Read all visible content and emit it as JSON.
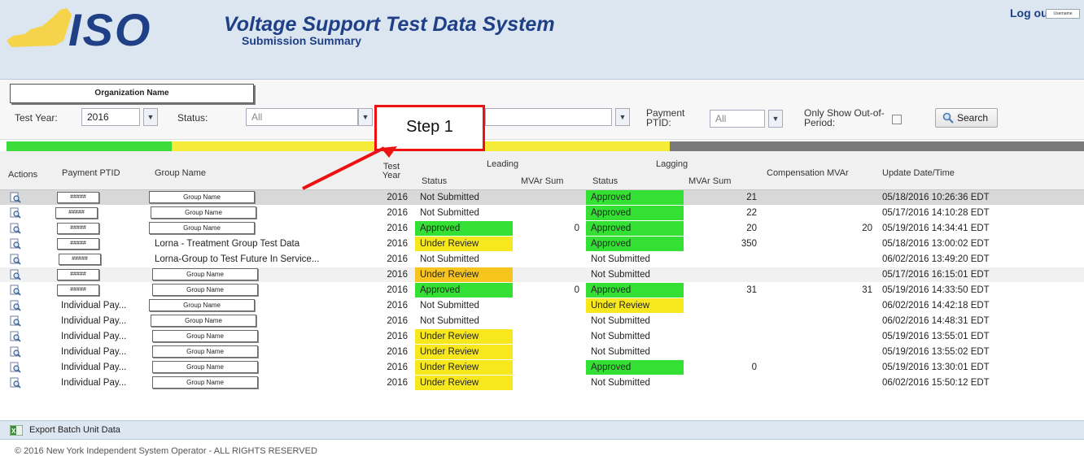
{
  "header": {
    "logo_text": "ISO",
    "title": "Voltage Support Test Data System",
    "subtitle": "Submission Summary",
    "logout_label": "Log out",
    "username": "Username"
  },
  "filters": {
    "organization": "Organization Name",
    "test_year_label": "Test Year:",
    "test_year_value": "2016",
    "status_label": "Status:",
    "status_value": "All",
    "payment_ptid_label": "Payment PTID:",
    "payment_ptid_value": "All",
    "out_of_period_label": "Only Show Out-of-Period:",
    "search_label": "Search"
  },
  "annotation": {
    "step_label": "Step 1",
    "color": "#e11111"
  },
  "colors": {
    "approved": "#34e034",
    "under_review": "#f7e81e",
    "under_review_orange": "#f7c51e",
    "bar_green": "#3ddc3d",
    "bar_yellow": "#f5ec3a",
    "bar_gray": "#7a7a7a"
  },
  "table": {
    "headers": {
      "actions": "Actions",
      "payment_ptid": "Payment PTID",
      "group_name": "Group Name",
      "test_year": "Test Year",
      "leading": "Leading",
      "lagging": "Lagging",
      "status": "Status",
      "mvar_sum": "MVAr Sum",
      "compensation": "Compensation MVAr",
      "update": "Update Date/Time"
    },
    "rows": [
      {
        "ptid": "#####",
        "ptid_boxed": true,
        "group": "Group Name",
        "group_boxed": true,
        "year": "2016",
        "lead_status": "Not Submitted",
        "lead_style": "none",
        "lead_mvar": "",
        "lag_status": "Approved",
        "lag_style": "approved",
        "lag_mvar": "21",
        "comp": "",
        "updated": "05/18/2016 10:26:36 EDT"
      },
      {
        "ptid": "#####",
        "ptid_boxed": true,
        "group": "Group Name",
        "group_boxed": true,
        "year": "2016",
        "lead_status": "Not Submitted",
        "lead_style": "none",
        "lead_mvar": "",
        "lag_status": "Approved",
        "lag_style": "approved",
        "lag_mvar": "22",
        "comp": "",
        "updated": "05/17/2016 14:10:28 EDT"
      },
      {
        "ptid": "#####",
        "ptid_boxed": true,
        "group": "Group Name",
        "group_boxed": true,
        "year": "2016",
        "lead_status": "Approved",
        "lead_style": "approved",
        "lead_mvar": "0",
        "lag_status": "Approved",
        "lag_style": "approved",
        "lag_mvar": "20",
        "comp": "20",
        "updated": "05/19/2016 14:34:41 EDT"
      },
      {
        "ptid": "#####",
        "ptid_boxed": true,
        "group": "Lorna - Treatment Group Test Data",
        "group_boxed": false,
        "year": "2016",
        "lead_status": "Under Review",
        "lead_style": "review",
        "lead_mvar": "",
        "lag_status": "Approved",
        "lag_style": "approved",
        "lag_mvar": "350",
        "comp": "",
        "updated": "05/18/2016 13:00:02 EDT"
      },
      {
        "ptid": "#####",
        "ptid_boxed": true,
        "group": "Lorna-Group to Test Future In Service...",
        "group_boxed": false,
        "year": "2016",
        "lead_status": "Not Submitted",
        "lead_style": "none",
        "lead_mvar": "",
        "lag_status": "Not Submitted",
        "lag_style": "none",
        "lag_mvar": "",
        "comp": "",
        "updated": "06/02/2016 13:49:20 EDT"
      },
      {
        "ptid": "#####",
        "ptid_boxed": true,
        "group": "Group Name",
        "group_boxed": true,
        "year": "2016",
        "lead_status": "Under Review",
        "lead_style": "review_orange",
        "lead_mvar": "",
        "lag_status": "Not Submitted",
        "lag_style": "none",
        "lag_mvar": "",
        "comp": "",
        "updated": "05/17/2016 16:15:01 EDT"
      },
      {
        "ptid": "#####",
        "ptid_boxed": true,
        "group": "Group Name",
        "group_boxed": true,
        "year": "2016",
        "lead_status": "Approved",
        "lead_style": "approved",
        "lead_mvar": "0",
        "lag_status": "Approved",
        "lag_style": "approved",
        "lag_mvar": "31",
        "comp": "31",
        "updated": "05/19/2016 14:33:50 EDT"
      },
      {
        "ptid": "Individual Pay...",
        "ptid_boxed": false,
        "group": "Group Name",
        "group_boxed": true,
        "year": "2016",
        "lead_status": "Not Submitted",
        "lead_style": "none",
        "lead_mvar": "",
        "lag_status": "Under Review",
        "lag_style": "review",
        "lag_mvar": "",
        "comp": "",
        "updated": "06/02/2016 14:42:18 EDT"
      },
      {
        "ptid": "Individual Pay...",
        "ptid_boxed": false,
        "group": "Group Name",
        "group_boxed": true,
        "year": "2016",
        "lead_status": "Not Submitted",
        "lead_style": "none",
        "lead_mvar": "",
        "lag_status": "Not Submitted",
        "lag_style": "none",
        "lag_mvar": "",
        "comp": "",
        "updated": "06/02/2016 14:48:31 EDT"
      },
      {
        "ptid": "Individual Pay...",
        "ptid_boxed": false,
        "group": "Group Name",
        "group_boxed": true,
        "year": "2016",
        "lead_status": "Under Review",
        "lead_style": "review",
        "lead_mvar": "",
        "lag_status": "Not Submitted",
        "lag_style": "none",
        "lag_mvar": "",
        "comp": "",
        "updated": "05/19/2016 13:55:01 EDT"
      },
      {
        "ptid": "Individual Pay...",
        "ptid_boxed": false,
        "group": "Group Name",
        "group_boxed": true,
        "year": "2016",
        "lead_status": "Under Review",
        "lead_style": "review",
        "lead_mvar": "",
        "lag_status": "Not Submitted",
        "lag_style": "none",
        "lag_mvar": "",
        "comp": "",
        "updated": "05/19/2016 13:55:02 EDT"
      },
      {
        "ptid": "Individual Pay...",
        "ptid_boxed": false,
        "group": "Group Name",
        "group_boxed": true,
        "year": "2016",
        "lead_status": "Under Review",
        "lead_style": "review",
        "lead_mvar": "",
        "lag_status": "Approved",
        "lag_style": "approved",
        "lag_mvar": "0",
        "comp": "",
        "updated": "05/19/2016 13:30:01 EDT"
      },
      {
        "ptid": "Individual Pay...",
        "ptid_boxed": false,
        "group": "Group Name",
        "group_boxed": true,
        "year": "2016",
        "lead_status": "Under Review",
        "lead_style": "review",
        "lead_mvar": "",
        "lag_status": "Not Submitted",
        "lag_style": "none",
        "lag_mvar": "",
        "comp": "",
        "updated": "06/02/2016 15:50:12 EDT"
      }
    ]
  },
  "footer": {
    "export_label": "Export Batch Unit Data",
    "copyright": "© 2016 New York Independent System Operator - ALL RIGHTS RESERVED"
  }
}
